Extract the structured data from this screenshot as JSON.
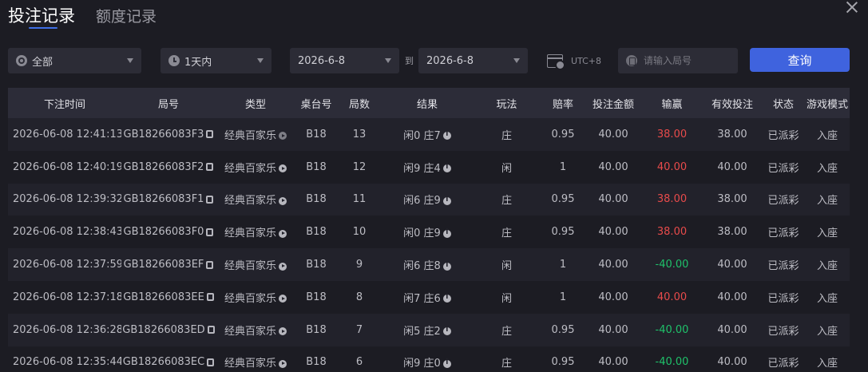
{
  "tabs": {
    "active": "投注记录",
    "inactive": "额度记录"
  },
  "filters": {
    "scope": "全部",
    "period": "1天内",
    "date_from": "2026-6-8",
    "date_to_label": "到",
    "date_to": "2026-6-8",
    "timezone": "UTC+8",
    "round_placeholder": "请输入局号",
    "query_label": "查询"
  },
  "table": {
    "headers": [
      "下注时间",
      "局号",
      "类型",
      "桌台号",
      "局数",
      "结果",
      "玩法",
      "赔率",
      "投注金额",
      "输赢",
      "有效投注",
      "状态",
      "游戏模式"
    ],
    "rows": [
      {
        "time": "2026-06-08 12:41:13",
        "round": "GB18266083F3",
        "type": "经典百家乐",
        "table": "B18",
        "game_no": "13",
        "result": "闲0 庄7",
        "bet": "庄",
        "odds": "0.95",
        "amount": "40.00",
        "winloss": "38.00",
        "valid": "38.00",
        "status": "已派彩",
        "mode": "入座"
      },
      {
        "time": "2026-06-08 12:40:19",
        "round": "GB18266083F2",
        "type": "经典百家乐",
        "table": "B18",
        "game_no": "12",
        "result": "闲9 庄4",
        "bet": "闲",
        "odds": "1",
        "amount": "40.00",
        "winloss": "40.00",
        "valid": "40.00",
        "status": "已派彩",
        "mode": "入座"
      },
      {
        "time": "2026-06-08 12:39:32",
        "round": "GB18266083F1",
        "type": "经典百家乐",
        "table": "B18",
        "game_no": "11",
        "result": "闲6 庄9",
        "bet": "庄",
        "odds": "0.95",
        "amount": "40.00",
        "winloss": "38.00",
        "valid": "38.00",
        "status": "已派彩",
        "mode": "入座"
      },
      {
        "time": "2026-06-08 12:38:43",
        "round": "GB18266083F0",
        "type": "经典百家乐",
        "table": "B18",
        "game_no": "10",
        "result": "闲0 庄9",
        "bet": "庄",
        "odds": "0.95",
        "amount": "40.00",
        "winloss": "38.00",
        "valid": "38.00",
        "status": "已派彩",
        "mode": "入座"
      },
      {
        "time": "2026-06-08 12:37:59",
        "round": "GB18266083EF",
        "type": "经典百家乐",
        "table": "B18",
        "game_no": "9",
        "result": "闲6 庄8",
        "bet": "闲",
        "odds": "1",
        "amount": "40.00",
        "winloss": "-40.00",
        "valid": "40.00",
        "status": "已派彩",
        "mode": "入座"
      },
      {
        "time": "2026-06-08 12:37:18",
        "round": "GB18266083EE",
        "type": "经典百家乐",
        "table": "B18",
        "game_no": "8",
        "result": "闲7 庄6",
        "bet": "闲",
        "odds": "1",
        "amount": "40.00",
        "winloss": "40.00",
        "valid": "40.00",
        "status": "已派彩",
        "mode": "入座"
      },
      {
        "time": "2026-06-08 12:36:28",
        "round": "GB18266083ED",
        "type": "经典百家乐",
        "table": "B18",
        "game_no": "7",
        "result": "闲5 庄2",
        "bet": "庄",
        "odds": "0.95",
        "amount": "40.00",
        "winloss": "-40.00",
        "valid": "40.00",
        "status": "已派彩",
        "mode": "入座"
      },
      {
        "time": "2026-06-08 12:35:44",
        "round": "GB18266083EC",
        "type": "经典百家乐",
        "table": "B18",
        "game_no": "6",
        "result": "闲9 庄0",
        "bet": "庄",
        "odds": "0.95",
        "amount": "40.00",
        "winloss": "-40.00",
        "valid": "40.00",
        "status": "已派彩",
        "mode": "入座"
      }
    ]
  },
  "colors": {
    "accent": "#3f63de",
    "win": "#e84b4b",
    "loss": "#1fc16a"
  }
}
